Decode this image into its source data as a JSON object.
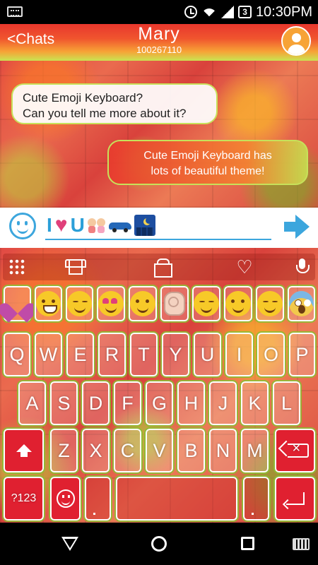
{
  "status_bar": {
    "battery_badge": "3",
    "clock": "10:30PM"
  },
  "header": {
    "back_label": "<Chats",
    "contact_name": "Mary",
    "contact_id": "100267110"
  },
  "chat": {
    "messages": [
      {
        "direction": "incoming",
        "text_line1": "Cute Emoji Keyboard?",
        "text_line2": "Can you tell me more about it?"
      },
      {
        "direction": "outgoing",
        "text_line1": "Cute Emoji Keyboard has",
        "text_line2": "lots of beautiful theme!"
      }
    ]
  },
  "input": {
    "emoji_sequence": [
      "I",
      "heart",
      "U",
      "couple",
      "car",
      "night-city"
    ],
    "text_i": "I",
    "text_heart": "♥",
    "text_u": "U"
  },
  "keyboard": {
    "toolbar_icons": [
      "grid-icon",
      "shirt-icon",
      "gift-icon",
      "heart-icon",
      "mic-icon"
    ],
    "heart_glyph": "♡",
    "emoji_row": [
      "sparkle-heart",
      "grin",
      "annoyed",
      "heart-eyes",
      "smile",
      "ok-hand",
      "kiss",
      "relieved",
      "sad",
      "scream"
    ],
    "row1": [
      "Q",
      "W",
      "E",
      "R",
      "T",
      "Y",
      "U",
      "I",
      "O",
      "P"
    ],
    "row2": [
      "A",
      "S",
      "D",
      "F",
      "G",
      "H",
      "J",
      "K",
      "L"
    ],
    "row3": [
      "Z",
      "X",
      "C",
      "V",
      "B",
      "N",
      "M"
    ],
    "symbols_label": "?123"
  },
  "theme_colors": {
    "accent_blue": "#3ca6dd",
    "header_red": "#e8372d",
    "key_red": "#e02030",
    "bubble_border": "#c7e15a"
  }
}
